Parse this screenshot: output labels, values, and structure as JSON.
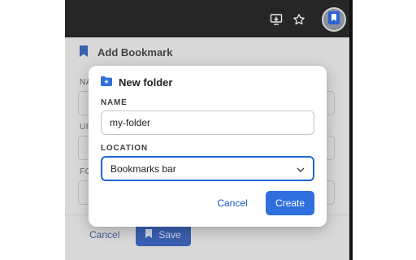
{
  "colors": {
    "accent": "#2f6fde",
    "frame_dark": "#1f1f1f",
    "dim_panel": "#d8d8d8"
  },
  "toolbar": {
    "install_icon": "install-app-icon",
    "star_icon": "star-icon",
    "extension_icon": "bookmark-extension-icon"
  },
  "background_dialog": {
    "title": "Add Bookmark",
    "fields": [
      {
        "label": "NA"
      },
      {
        "label": "UR"
      },
      {
        "label": "FO"
      }
    ],
    "cancel_label": "Cancel",
    "save_label": "Save"
  },
  "modal": {
    "title": "New folder",
    "name_label": "NAME",
    "name_value": "my-folder",
    "location_label": "LOCATION",
    "location_value": "Bookmarks bar",
    "cancel_label": "Cancel",
    "create_label": "Create"
  }
}
